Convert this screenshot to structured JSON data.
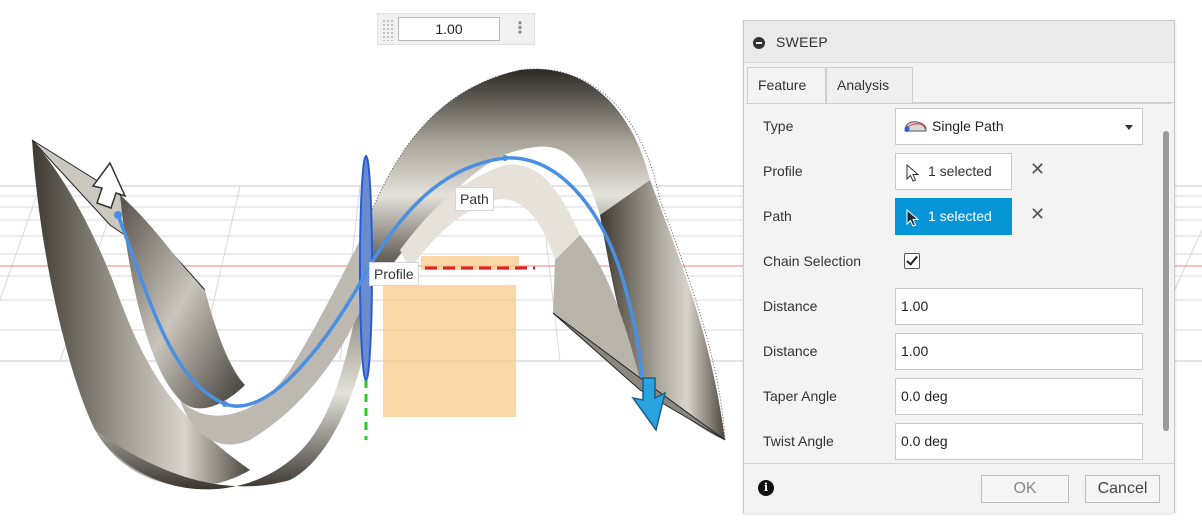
{
  "canvas": {
    "value_input": "1.00",
    "path_label": "Path",
    "profile_label": "Profile"
  },
  "dialog": {
    "title": "SWEEP",
    "tabs": [
      {
        "label": "Feature",
        "active": true
      },
      {
        "label": "Analysis",
        "active": false
      }
    ],
    "fields": {
      "type": {
        "label": "Type",
        "value": "Single Path"
      },
      "profile": {
        "label": "Profile",
        "value": "1 selected"
      },
      "path": {
        "label": "Path",
        "value": "1 selected"
      },
      "chain_selection": {
        "label": "Chain Selection",
        "checked": true
      },
      "distance1": {
        "label": "Distance",
        "value": "1.00"
      },
      "distance2": {
        "label": "Distance",
        "value": "1.00"
      },
      "taper": {
        "label": "Taper Angle",
        "value": "0.0 deg"
      },
      "twist": {
        "label": "Twist Angle",
        "value": "0.0 deg"
      }
    },
    "buttons": {
      "ok": "OK",
      "cancel": "Cancel"
    }
  },
  "colors": {
    "accent": "#0696d7",
    "path_curve": "#4a90e2",
    "surface": "#8a857a",
    "profile_plane": "#f7c98a"
  }
}
